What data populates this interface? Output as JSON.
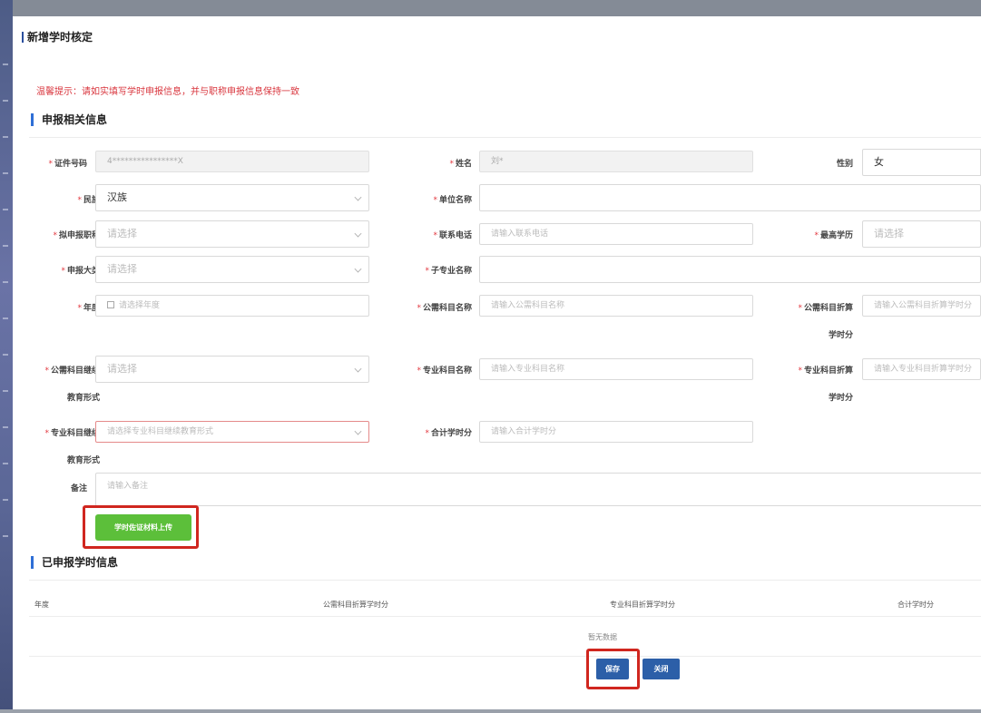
{
  "dialog": {
    "title": "新增学时核定"
  },
  "tip": "温馨提示：请如实填写学时申报信息，并与职称申报信息保持一致",
  "section1": {
    "title": "申报相关信息"
  },
  "form": {
    "id_label": "证件号码",
    "id_value": "4****************X",
    "name_label": "姓名",
    "name_value": "刘*",
    "gender_label": "性别",
    "gender_value": "女",
    "ethnic_label": "民族",
    "ethnic_value": "汉族",
    "unit_label": "单位名称",
    "title_apply_label": "拟申报职称",
    "title_apply_ph": "请选择",
    "phone_label": "联系电话",
    "phone_ph": "请输入联系电话",
    "edu_label": "最高学历",
    "edu_ph": "请选择",
    "category_label": "申报大类",
    "category_ph": "请选择",
    "submajor_label": "子专业名称",
    "year_label": "年度",
    "year_ph": "请选择年度",
    "pub_name_label": "公需科目名称",
    "pub_name_ph": "请输入公需科目名称",
    "pub_hours_label_a": "公需科目折算",
    "pub_hours_label_b": "学时分",
    "pub_hours_ph": "请输入公需科目折算学时分",
    "pub_form_label_a": "公需科目继续",
    "pub_form_label_b": "教育形式",
    "pub_form_ph": "请选择",
    "pro_name_label": "专业科目名称",
    "pro_name_ph": "请输入专业科目名称",
    "pro_hours_label_a": "专业科目折算",
    "pro_hours_label_b": "学时分",
    "pro_hours_ph": "请输入专业科目折算学时分",
    "pro_form_label_a": "专业科目继续",
    "pro_form_label_b": "教育形式",
    "pro_form_ph": "请选择专业科目继续教育形式",
    "total_label": "合计学时分",
    "total_ph": "请输入合计学时分",
    "remark_label": "备注",
    "remark_ph": "请输入备注",
    "upload_btn": "学时佐证材料上传"
  },
  "section2": {
    "title": "已申报学时信息"
  },
  "table": {
    "headers": [
      "年度",
      "公需科目折算学时分",
      "专业科目折算学时分",
      "合计学时分"
    ],
    "empty_text": "暂无数据"
  },
  "actions": {
    "save": "保存",
    "close": "关闭"
  },
  "colors": {
    "required": "#e2383f",
    "primary": "#2c5fa8",
    "upload": "#5cbf3a",
    "highlight": "#d0261f",
    "tip": "#d9363e"
  }
}
